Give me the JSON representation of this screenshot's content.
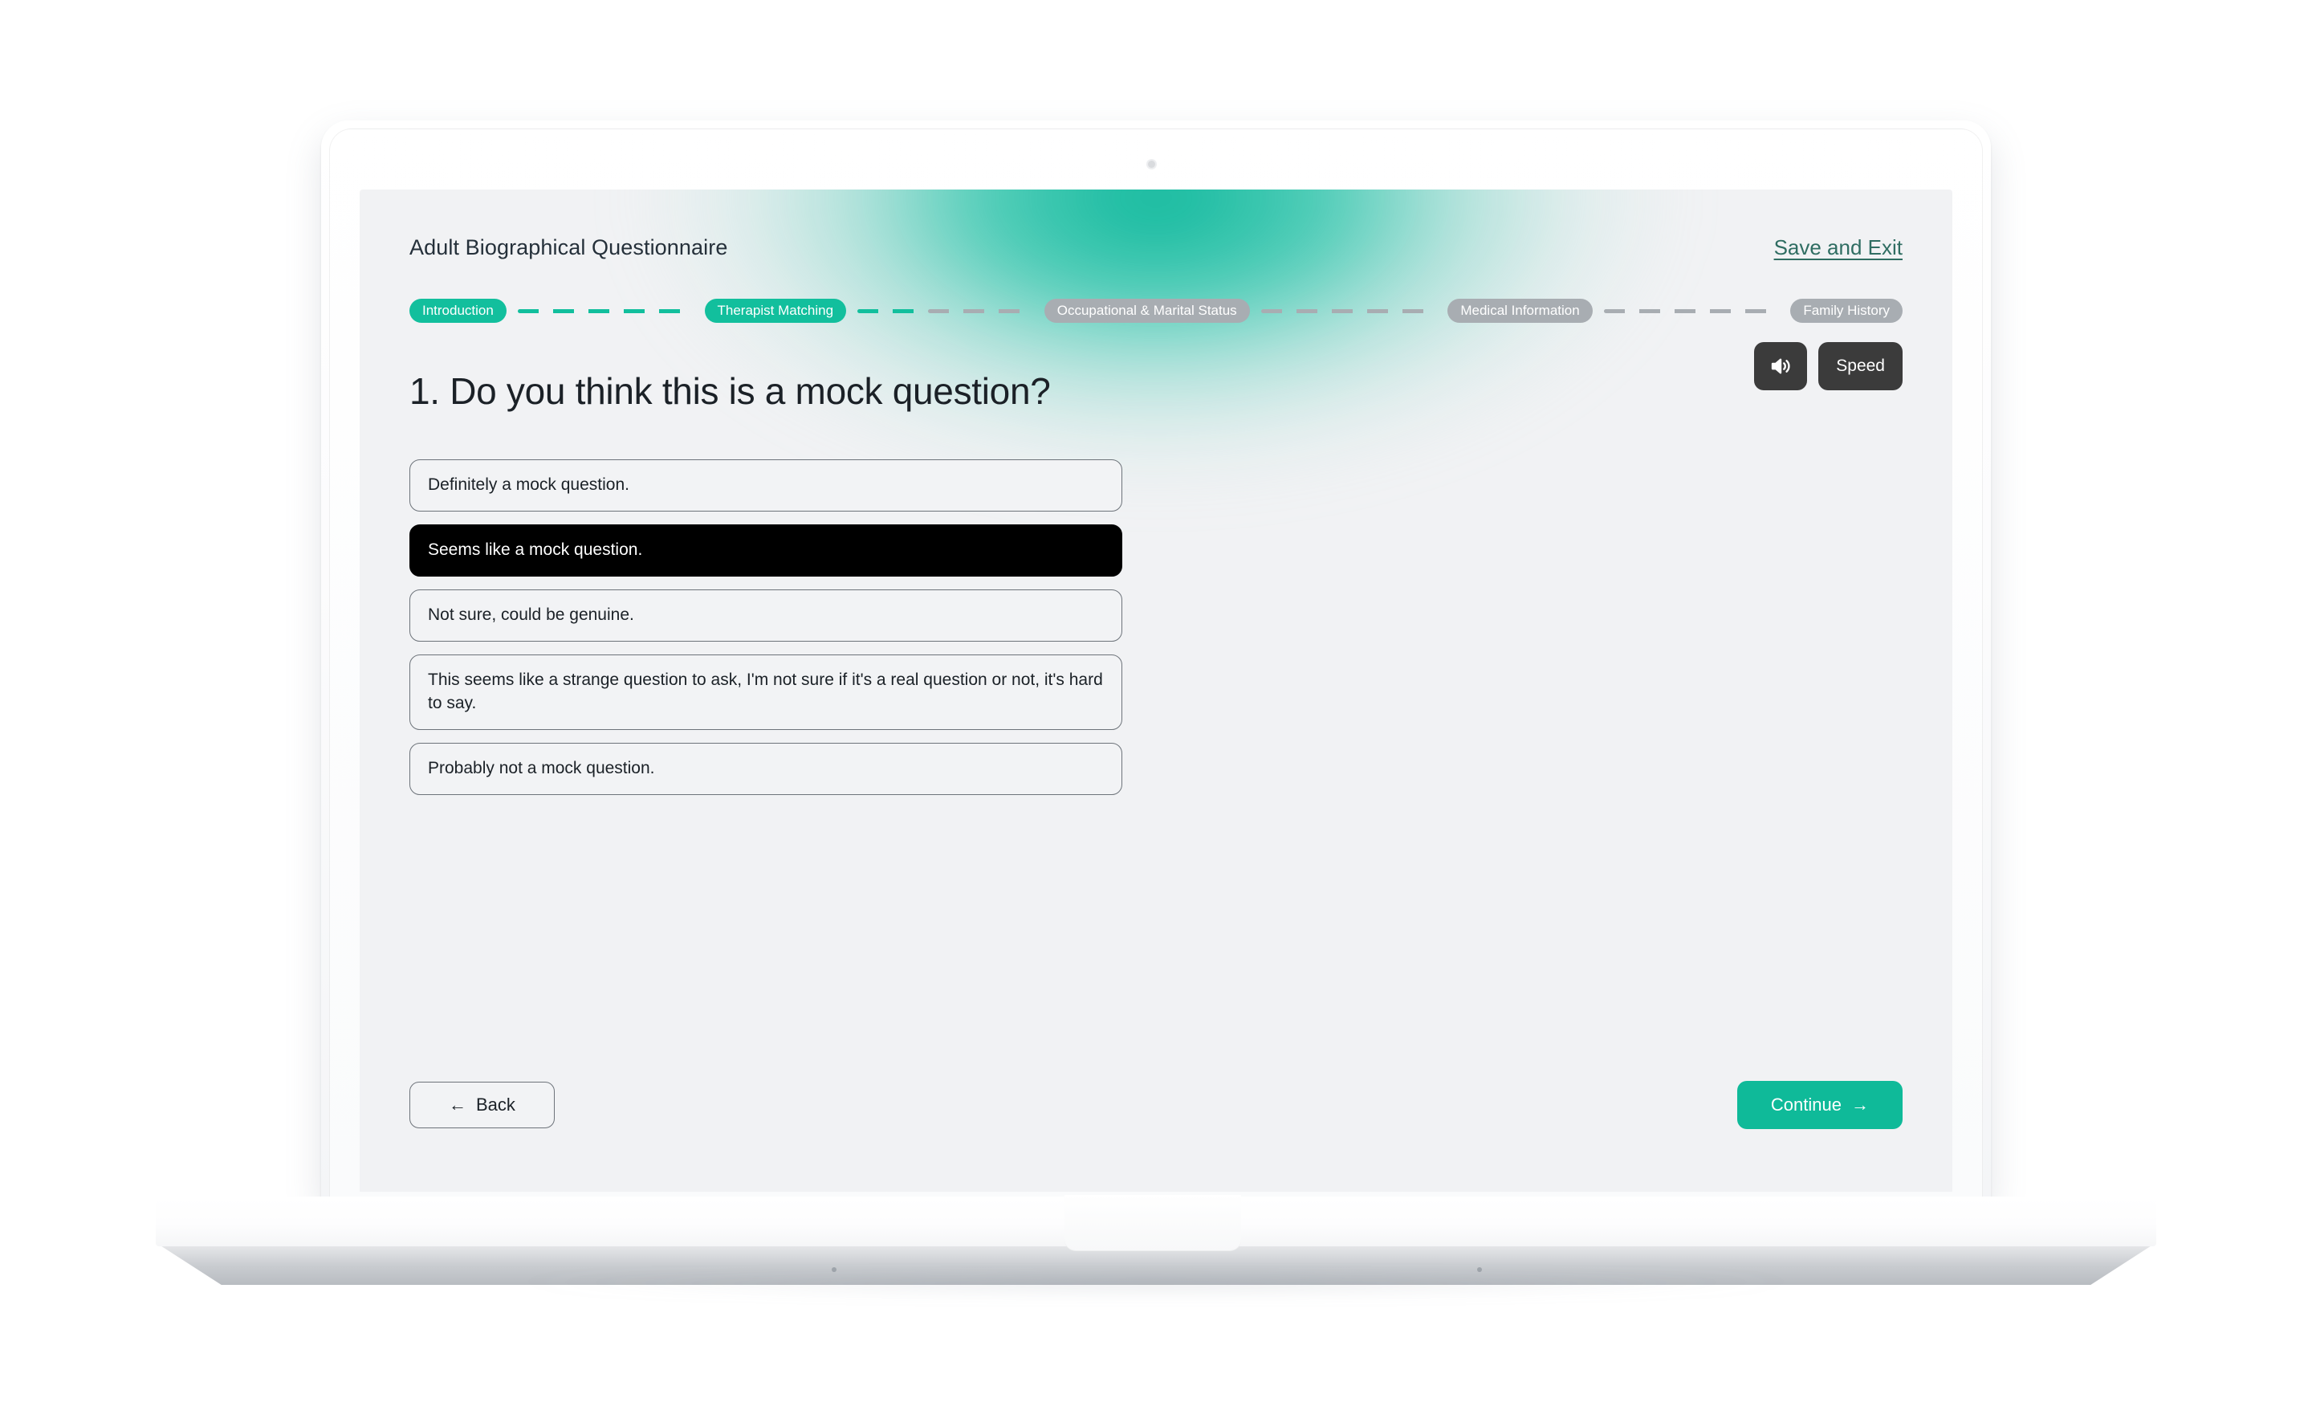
{
  "header": {
    "app_title": "Adult Biographical Questionnaire",
    "save_exit_label": "Save and Exit"
  },
  "stepper": {
    "steps": [
      {
        "label": "Introduction",
        "state": "done"
      },
      {
        "label": "Therapist Matching",
        "state": "done"
      },
      {
        "label": "Occupational & Marital Status",
        "state": "todo"
      },
      {
        "label": "Medical Information",
        "state": "todo"
      },
      {
        "label": "Family History",
        "state": "todo"
      }
    ],
    "active_color": "#12bf9d",
    "inactive_color": "#a8adb2"
  },
  "question": {
    "number": "1.",
    "text": "1. Do you think this is a mock question?"
  },
  "audio": {
    "speaker_icon": "volume-speaker-icon",
    "speed_label": "Speed"
  },
  "options": [
    {
      "label": "Definitely a mock question.",
      "selected": false
    },
    {
      "label": "Seems like a mock question.",
      "selected": true
    },
    {
      "label": "Not sure, could be genuine.",
      "selected": false
    },
    {
      "label": "This seems like a strange question to ask, I'm not sure if it's a real question or not, it's hard to say.",
      "selected": false
    },
    {
      "label": "Probably not a mock question.",
      "selected": false
    }
  ],
  "footer": {
    "back_label": "Back",
    "back_arrow": "←",
    "continue_label": "Continue",
    "continue_arrow": "→",
    "continue_color": "#0fba99"
  }
}
